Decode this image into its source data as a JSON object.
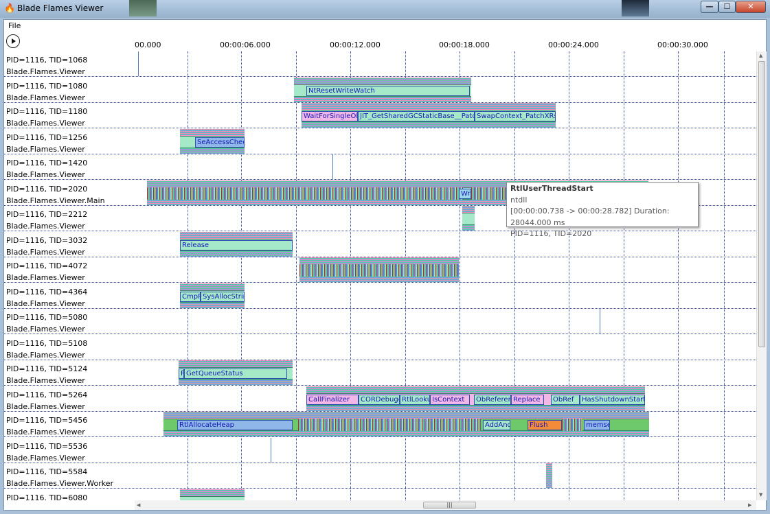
{
  "window": {
    "title": "Blade Flames Viewer",
    "minimize_glyph": "—",
    "maximize_glyph": "☐",
    "close_glyph": "✕"
  },
  "menu": {
    "file": "File"
  },
  "ruler": {
    "ticks": [
      "00.000",
      "00:00:06.000",
      "00:00:12.000",
      "00:00:18.000",
      "00:00:24.000",
      "00:00:30.000"
    ]
  },
  "lanes": [
    {
      "line1": "PID=1116, TID=1068",
      "line2": "Blade.Flames.Viewer"
    },
    {
      "line1": "PID=1116, TID=1080",
      "line2": "Blade.Flames.Viewer"
    },
    {
      "line1": "PID=1116, TID=1180",
      "line2": "Blade.Flames.Viewer"
    },
    {
      "line1": "PID=1116, TID=1256",
      "line2": "Blade.Flames.Viewer"
    },
    {
      "line1": "PID=1116, TID=1420",
      "line2": "Blade.Flames.Viewer"
    },
    {
      "line1": "PID=1116, TID=2020",
      "line2": "Blade.Flames.Viewer.Main"
    },
    {
      "line1": "PID=1116, TID=2212",
      "line2": "Blade.Flames.Viewer"
    },
    {
      "line1": "PID=1116, TID=3032",
      "line2": "Blade.Flames.Viewer"
    },
    {
      "line1": "PID=1116, TID=4072",
      "line2": "Blade.Flames.Viewer"
    },
    {
      "line1": "PID=1116, TID=4364",
      "line2": "Blade.Flames.Viewer"
    },
    {
      "line1": "PID=1116, TID=5080",
      "line2": "Blade.Flames.Viewer"
    },
    {
      "line1": "PID=1116, TID=5108",
      "line2": "Blade.Flames.Viewer"
    },
    {
      "line1": "PID=1116, TID=5124",
      "line2": "Blade.Flames.Viewer"
    },
    {
      "line1": "PID=1116, TID=5264",
      "line2": "Blade.Flames.Viewer"
    },
    {
      "line1": "PID=1116, TID=5456",
      "line2": "Blade.Flames.Viewer"
    },
    {
      "line1": "PID=1116, TID=5536",
      "line2": "Blade.Flames.Viewer"
    },
    {
      "line1": "PID=1116, TID=5584",
      "line2": "Blade.Flames.Viewer.Worker"
    },
    {
      "line1": "PID=1116. TID=6080",
      "line2": ""
    }
  ],
  "frames": {
    "ntresetwritewatch": "NtResetWriteWatch",
    "waitforsingleobj": "WaitForSingleObj",
    "jit_getsharedgc": "JIT_GetSharedGCStaticBase__PatchT",
    "swapcontext": "SwapContext_PatchXRstc",
    "seaccesscheck": "SeAccessCheck",
    "wr": "Wr",
    "release": "Release",
    "cmpp": "CmpP",
    "sysallocstring": "SysAllocStrin",
    "getqueuestatus": "GetQueueStatus",
    "getqueue_prefix": "R",
    "callfinalizer": "CallFinalizer",
    "cordebugg": "CORDebugg",
    "rtllooku": "RtlLooku",
    "iscontext": "IsContext",
    "obreferen": "ObReferen",
    "replace": "Replace",
    "obref": "ObRef",
    "hasshutdown": "HasShutdownStarte",
    "rtlallocateheap": "RtlAllocateHeap",
    "addand": "AddAnd",
    "flush": "Flush",
    "memse": "memse"
  },
  "tooltip": {
    "title": "RtlUserThreadStart",
    "module": "ntdll",
    "timing": "[00:00:00.738 -> 00:00:28.782] Duration: 28044.000 ms",
    "thread": "PID=1116, TID=2020"
  },
  "scrollbar": {
    "hthumb_glyph": "|||"
  },
  "colors": {
    "teal": "#9be0d8",
    "green": "#9ce3b0",
    "pink": "#ee8cc0",
    "blue_label": "#1418b8",
    "grid": "#2a3fa0"
  }
}
